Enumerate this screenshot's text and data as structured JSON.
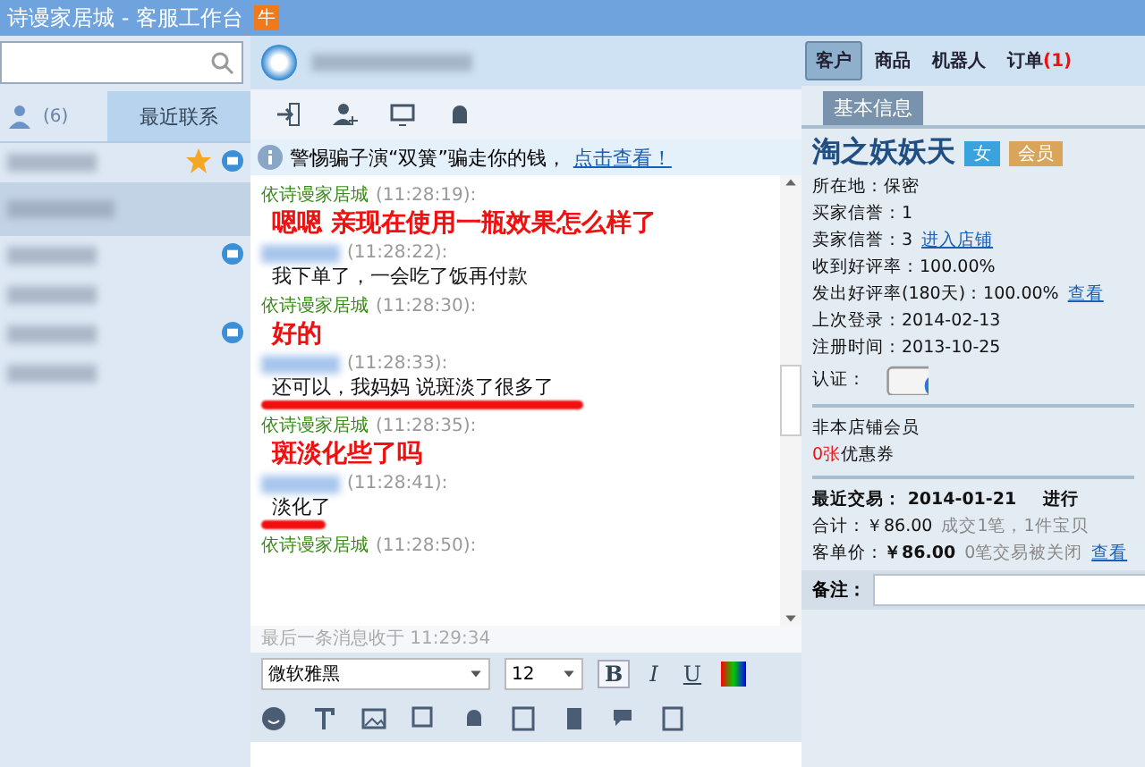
{
  "window": {
    "title": "诗谩家居城 - 客服工作台",
    "badge": "牛"
  },
  "contacts": {
    "count": "(6)",
    "recent_tab": "最近联系",
    "items": [
      {
        "selected": false,
        "starred": true,
        "message": true
      },
      {
        "selected": true,
        "starred": false,
        "message": false
      },
      {
        "selected": false,
        "starred": false,
        "message": true
      },
      {
        "selected": false,
        "starred": false,
        "message": false
      },
      {
        "selected": false,
        "starred": false,
        "message": true
      },
      {
        "selected": false,
        "starred": false,
        "message": false
      }
    ]
  },
  "notice": {
    "text": "警惕骗子演“双簧”骗走你的钱，",
    "link": "点击查看！"
  },
  "messages": [
    {
      "kind": "shop",
      "sender": "依诗谩家居城",
      "time": "(11:28:19):",
      "text": "嗯嗯 亲现在使用一瓶效果怎么样了",
      "redacted": false
    },
    {
      "kind": "customer",
      "time": "(11:28:22):",
      "text": "我下单了，一会吃了饭再付款",
      "redacted": false
    },
    {
      "kind": "shop",
      "sender": "依诗谩家居城",
      "time": "(11:28:30):",
      "text": "好的",
      "redacted": false
    },
    {
      "kind": "customer",
      "time": "(11:28:33):",
      "text": "还可以，我妈妈 说斑淡了很多了",
      "redacted": true
    },
    {
      "kind": "shop",
      "sender": "依诗谩家居城",
      "time": "(11:28:35):",
      "text": "斑淡化些了吗",
      "redacted": false
    },
    {
      "kind": "customer",
      "time": "(11:28:41):",
      "text": "淡化了",
      "redacted": true
    },
    {
      "kind": "shop",
      "sender": "依诗谩家居城",
      "time": "(11:28:50):",
      "redacted": false
    }
  ],
  "last_received": "最后一条消息收于 11:29:34",
  "format": {
    "font": "微软雅黑",
    "size": "12",
    "bold": "B",
    "italic": "I",
    "underline": "U"
  },
  "right_tabs": [
    {
      "label": "客户",
      "selected": true
    },
    {
      "label": "商品",
      "selected": false
    },
    {
      "label": "机器人",
      "selected": false
    },
    {
      "label": "订单",
      "selected": false,
      "count": "(1)"
    }
  ],
  "sub_tab": "基本信息",
  "customer": {
    "name": "淘之妖妖天",
    "gender": "女",
    "member": "会员",
    "rows": [
      {
        "text": "所在地：保密"
      },
      {
        "text": "买家信誉：1"
      },
      {
        "text": "卖家信誉：3",
        "link": "进入店铺"
      },
      {
        "text": "收到好评率：100.00%"
      },
      {
        "text": "发出好评率(180天)：100.00%",
        "link": "查看"
      },
      {
        "text": "上次登录：2014-02-13"
      },
      {
        "text": "注册时间：2013-10-25"
      }
    ],
    "cert_label": "认证：",
    "membership": "非本店铺会员",
    "coupon_count": "0张",
    "coupon_label": "优惠券"
  },
  "trade": {
    "label": "最近交易：",
    "date": "2014-01-21",
    "status": "进行",
    "total_label": "合计：",
    "total": "￥86.00",
    "total_note": "成交1笔，1件宝贝",
    "unit_label": "客单价：",
    "unit": "￥86.00",
    "closed": "0笔交易被关闭",
    "link": "查看"
  },
  "note_label": "备注："
}
